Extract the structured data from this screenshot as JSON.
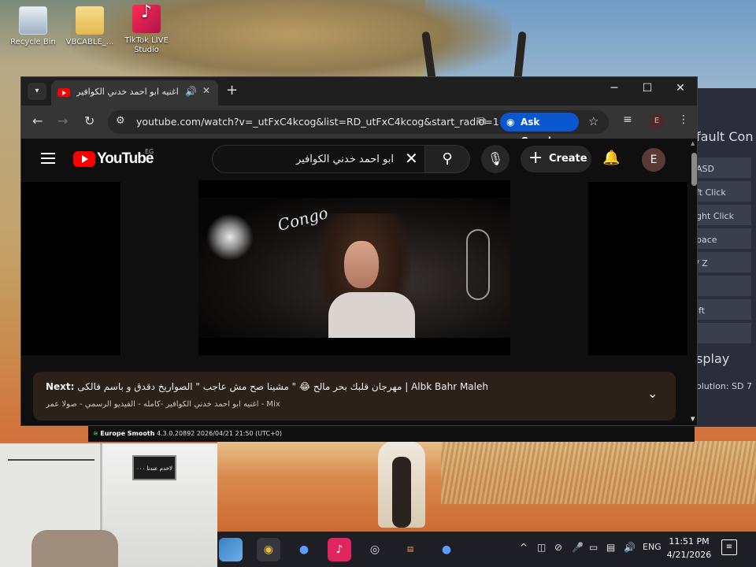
{
  "desktop": {
    "icons": [
      {
        "label": "Recycle Bin"
      },
      {
        "label": "VBCABLE_..."
      },
      {
        "label": "TikTok LIVE Studio"
      }
    ]
  },
  "background_app": {
    "title": "fault Con",
    "rows": [
      "ASD",
      "ft Click",
      "ght Click",
      "pace",
      "/ Z",
      "",
      "ift",
      ""
    ],
    "display_heading": "splay",
    "resolution": "olution: SD 7"
  },
  "browser": {
    "tab": {
      "title": "اغنيه ابو احمد خدني الكوافير"
    },
    "address": "youtube.com/watch?v=_utFxC4kcog&list=RD_utFxC4kcog&start_radio=1",
    "ask_google": "Ask Google",
    "profile_initial": "E"
  },
  "youtube": {
    "logo_text": "YouTube",
    "country_code": "EG",
    "search_query": "ابو احمد خدني الكوافير",
    "create_label": "Create",
    "avatar_initial": "E",
    "next_label": "Next:",
    "next_title": "مهرجان قلبك بحر مالح 😂 \" مشينا صح مش عاجب \" الصواريخ دقدق و باسم فالكى | Albk Bahr Maleh",
    "mix_line": "اغنيه ابو احمد خدني الكوافير -كامله - الفيديو الرسمي - صولا عمر - Mix",
    "video_neon": "Congo"
  },
  "status_strip": {
    "label": "Europe Smooth",
    "detail": "4.3.0.20892 2026/04/21 21:50 (UTC+0)"
  },
  "webcam": {
    "sign_text": "لاخدم عندنا ٠٠٠"
  },
  "taskbar": {
    "language": "ENG",
    "time": "11:51 PM",
    "date": "4/21/2026"
  }
}
